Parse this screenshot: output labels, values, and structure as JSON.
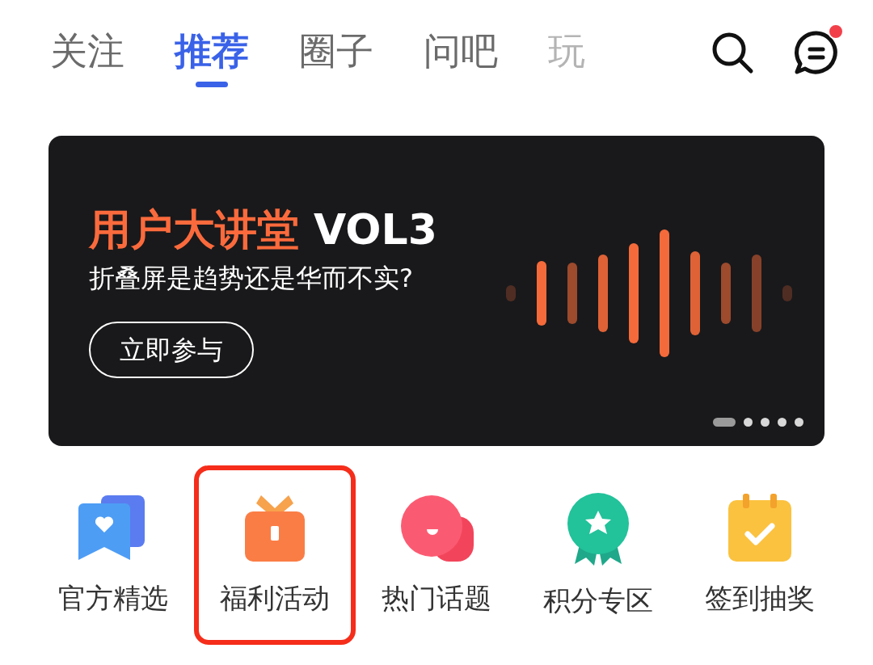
{
  "tabs": [
    {
      "label": "关注",
      "selected": false,
      "faded": false
    },
    {
      "label": "推荐",
      "selected": true,
      "faded": false
    },
    {
      "label": "圈子",
      "selected": false,
      "faded": false
    },
    {
      "label": "问吧",
      "selected": false,
      "faded": false
    },
    {
      "label": "玩",
      "selected": false,
      "faded": true
    }
  ],
  "messages": {
    "unread": true
  },
  "banner": {
    "title_highlight": "用户大讲堂",
    "title_rest": "VOL3",
    "subtitle": "折叠屏是趋势还是华而不实?",
    "button": "立即参与",
    "pages": [
      {
        "selected": true
      },
      {
        "selected": false
      },
      {
        "selected": false
      },
      {
        "selected": false
      },
      {
        "selected": false
      }
    ]
  },
  "shortcuts": [
    {
      "label": "官方精选",
      "kind": "bookmark",
      "highlighted": false
    },
    {
      "label": "福利活动",
      "kind": "gift",
      "highlighted": true
    },
    {
      "label": "热门话题",
      "kind": "chat",
      "highlighted": false
    },
    {
      "label": "积分专区",
      "kind": "medal",
      "highlighted": false
    },
    {
      "label": "签到抽奖",
      "kind": "calendar",
      "highlighted": false
    }
  ]
}
